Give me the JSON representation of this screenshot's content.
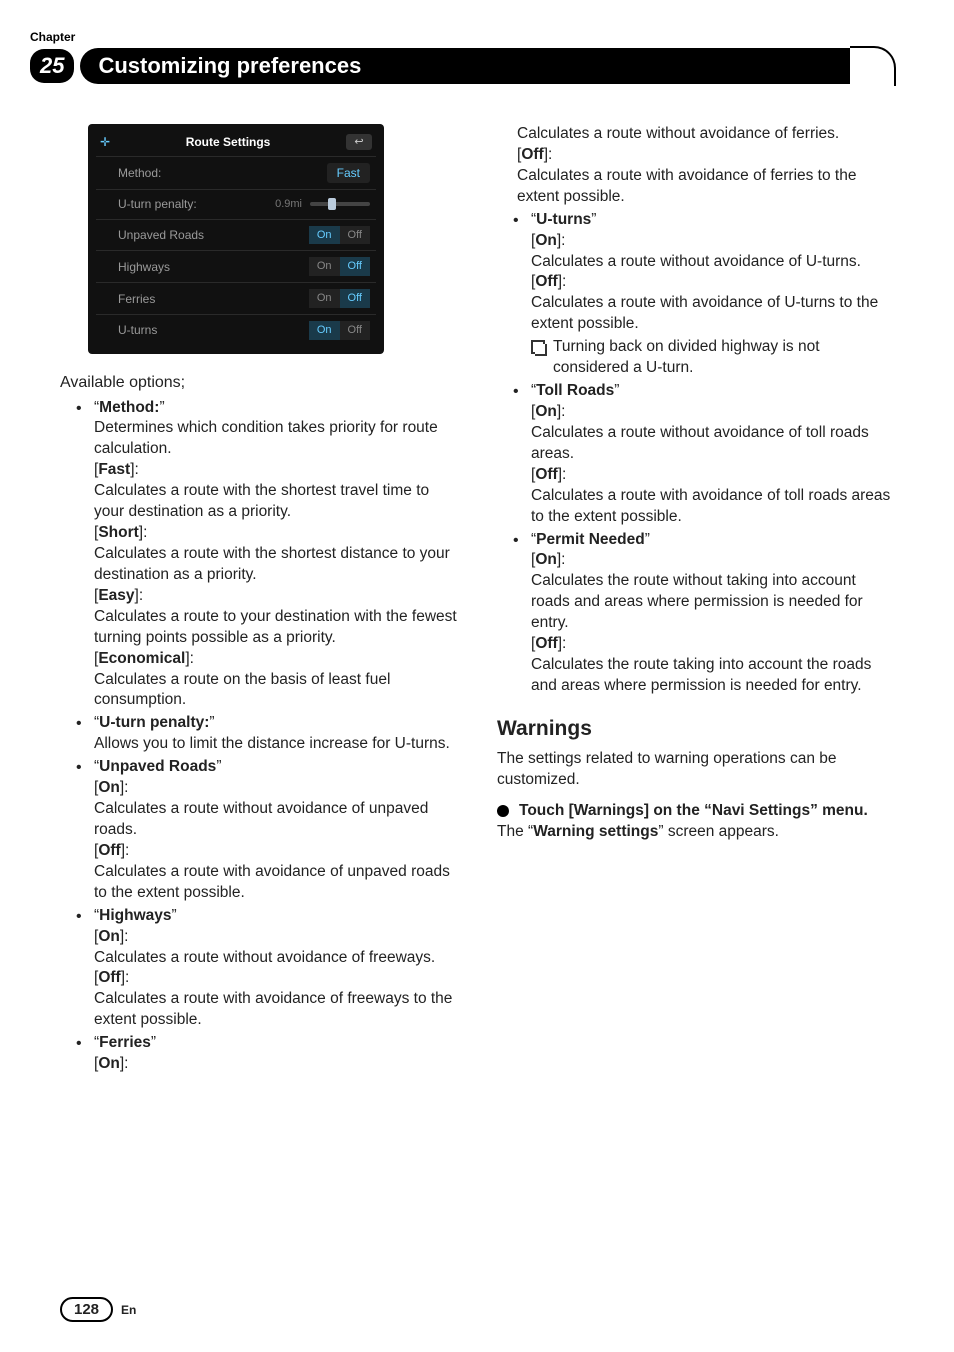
{
  "chapterLabel": "Chapter",
  "chapterNumber": "25",
  "headerTitle": "Customizing preferences",
  "screenshot": {
    "title": "Route Settings",
    "backGlyph": "↩",
    "rows": {
      "method": {
        "label": "Method:",
        "value": "Fast"
      },
      "uturnPenalty": {
        "label": "U-turn penalty:",
        "dist": "0.9mi"
      },
      "unpaved": {
        "label": "Unpaved Roads",
        "on": "On",
        "off": "Off",
        "active": "on"
      },
      "highways": {
        "label": "Highways",
        "on": "On",
        "off": "Off",
        "active": "off"
      },
      "ferries": {
        "label": "Ferries",
        "on": "On",
        "off": "Off",
        "active": "off"
      },
      "uturns": {
        "label": "U-turns",
        "on": "On",
        "off": "Off",
        "active": "on"
      }
    }
  },
  "availableOptions": "Available options;",
  "items": {
    "method": {
      "name": "Method:",
      "desc": "Determines which condition takes priority for route calculation.",
      "fast": {
        "tag": "Fast",
        "desc": "Calculates a route with the shortest travel time to your destination as a priority."
      },
      "short": {
        "tag": "Short",
        "desc": "Calculates a route with the shortest distance to your destination as a priority."
      },
      "easy": {
        "tag": "Easy",
        "desc": "Calculates a route to your destination with the fewest turning points possible as a priority."
      },
      "economical": {
        "tag": "Economical",
        "desc": "Calculates a route on the basis of least fuel consumption."
      }
    },
    "uturnPenalty": {
      "name": "U-turn penalty:",
      "desc": "Allows you to limit the distance increase for U-turns."
    },
    "unpaved": {
      "name": "Unpaved Roads",
      "on": {
        "tag": "On",
        "desc": "Calculates a route without avoidance of unpaved roads."
      },
      "off": {
        "tag": "Off",
        "desc": "Calculates a route with avoidance of unpaved roads to the extent possible."
      }
    },
    "highways": {
      "name": "Highways",
      "on": {
        "tag": "On",
        "desc": "Calculates a route without avoidance of freeways."
      },
      "off": {
        "tag": "Off",
        "desc": "Calculates a route with avoidance of freeways to the extent possible."
      }
    },
    "ferries": {
      "name": "Ferries",
      "onTag": "On",
      "onDesc": "Calculates a route without avoidance of ferries.",
      "offTag": "Off",
      "offDesc": "Calculates a route with avoidance of ferries to the extent possible."
    },
    "uturns": {
      "name": "U-turns",
      "onTag": "On",
      "onDesc": "Calculates a route without avoidance of U-turns.",
      "offTag": "Off",
      "offDesc": "Calculates a route with avoidance of U-turns to the extent possible.",
      "note": "Turning back on divided highway is not considered a U-turn."
    },
    "toll": {
      "name": "Toll Roads",
      "onTag": "On",
      "onDesc": "Calculates a route without avoidance of toll roads areas.",
      "offTag": "Off",
      "offDesc": "Calculates a route with avoidance of toll roads areas to the extent possible."
    },
    "permit": {
      "name": "Permit Needed",
      "onTag": "On",
      "onDesc": "Calculates the route without taking into account roads and areas where permission is needed for entry.",
      "offTag": "Off",
      "offDesc": "Calculates the route taking into account the roads and areas where permission is needed for entry."
    }
  },
  "warnings": {
    "heading": "Warnings",
    "intro": "The settings related to warning operations can be customized.",
    "step1a": "Touch [Warnings] on the ",
    "step1b": "“",
    "step1c": "Navi Settings",
    "step1d": "”",
    "step1e": " menu.",
    "result1": "The ",
    "result2": "“",
    "result3": "Warning settings",
    "result4": "”",
    "result5": " screen appears."
  },
  "pageNumber": "128",
  "lang": "En"
}
